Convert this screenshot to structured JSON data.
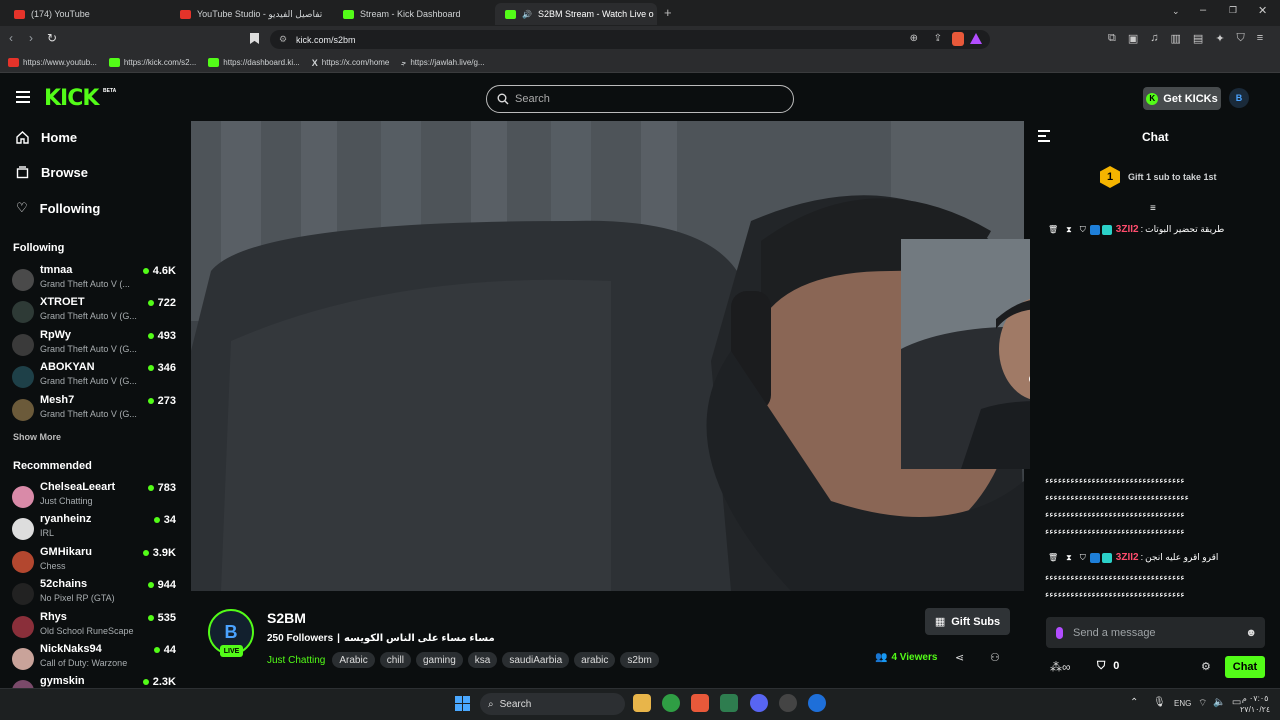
{
  "browser": {
    "tabs": [
      {
        "label": "(174) YouTube"
      },
      {
        "label": "YouTube Studio - تفاصيل الفيديو"
      },
      {
        "label": "Stream - Kick Dashboard"
      },
      {
        "label": "S2BM Stream - Watch Live o"
      }
    ],
    "url": "kick.com/s2bm",
    "bookmarks": [
      {
        "label": "https://www.youtub..."
      },
      {
        "label": "https://kick.com/s2..."
      },
      {
        "label": "https://dashboard.ki..."
      },
      {
        "label": "https://x.com/home"
      },
      {
        "label": "https://jawlah.live/g..."
      }
    ]
  },
  "header": {
    "logo": "KICK",
    "beta": "BETA",
    "search_placeholder": "Search",
    "get_kicks": "Get KICKs",
    "user_initial": "B"
  },
  "sidebar": {
    "nav": [
      {
        "label": "Home",
        "icon": "home-icon"
      },
      {
        "label": "Browse",
        "icon": "browse-icon"
      },
      {
        "label": "Following",
        "icon": "heart-icon"
      }
    ],
    "following_title": "Following",
    "following": [
      {
        "name": "tmnaa",
        "category": "Grand Theft Auto V (...",
        "viewers": "4.6K",
        "color": "#4a4a4a"
      },
      {
        "name": "XTROET",
        "category": "Grand Theft Auto V (G...",
        "viewers": "722",
        "color": "#2e3a36"
      },
      {
        "name": "RpWy",
        "category": "Grand Theft Auto V (G...",
        "viewers": "493",
        "color": "#3a3a3a"
      },
      {
        "name": "ABOKYAN",
        "category": "Grand Theft Auto V (G...",
        "viewers": "346",
        "color": "#1e4048"
      },
      {
        "name": "Mesh7",
        "category": "Grand Theft Auto V (G...",
        "viewers": "273",
        "color": "#6b5a3a"
      }
    ],
    "show_more": "Show More",
    "recommended_title": "Recommended",
    "recommended": [
      {
        "name": "ChelseaLeeart",
        "category": "Just Chatting",
        "viewers": "783",
        "color": "#d98aa8"
      },
      {
        "name": "ryanheinz",
        "category": "IRL",
        "viewers": "34",
        "color": "#dddddd"
      },
      {
        "name": "GMHikaru",
        "category": "Chess",
        "viewers": "3.9K",
        "color": "#b3472f"
      },
      {
        "name": "52chains",
        "category": "No Pixel RP (GTA)",
        "viewers": "944",
        "color": "#222222"
      },
      {
        "name": "Rhys",
        "category": "Old School RuneScape",
        "viewers": "535",
        "color": "#8a2f3a"
      },
      {
        "name": "NickNaks94",
        "category": "Call of Duty: Warzone",
        "viewers": "44",
        "color": "#c9a39a"
      },
      {
        "name": "gymskin",
        "category": "",
        "viewers": "2.3K",
        "color": "#7a4a6a"
      }
    ]
  },
  "stream": {
    "channel": "S2BM",
    "avatar_initial": "B",
    "live": "LIVE",
    "followers": "250 Followers",
    "title": "مساء مساء على الناس الكويسه",
    "category": "Just Chatting",
    "tags": [
      "Arabic",
      "chill",
      "gaming",
      "ksa",
      "saudiAarbia",
      "arabic",
      "s2bm"
    ],
    "viewers": "4 Viewers",
    "gift_subs": "Gift Subs"
  },
  "chat": {
    "title": "Chat",
    "gift_prompt": "Gift 1 sub to take 1st",
    "gift_rank": "1",
    "messages": [
      {
        "user": "3ZII2",
        "text": "طريقة تحضير البوتات"
      },
      {
        "user": "",
        "text": "ءءءءءءءءءءءءءءءءءءءءءءءءءءءءءءءءء"
      },
      {
        "user": "",
        "text": "ءءءءءءءءءءءءءءءءءءءءءءءءءءءءءءءءءء"
      },
      {
        "user": "",
        "text": "ءءءءءءءءءءءءءءءءءءءءءءءءءءءءءءءءء"
      },
      {
        "user": "",
        "text": "ءءءءءءءءءءءءءءءءءءءءءءءءءءءءءءءءء"
      },
      {
        "user": "3ZII2",
        "text": "اقرو اقرو عليه انجن"
      },
      {
        "user": "",
        "text": "ءءءءءءءءءءءءءءءءءءءءءءءءءءءءءءءءء"
      },
      {
        "user": "",
        "text": "ءءءءءءءءءءءءءءءءءءءءءءءءءءءءءءءءء"
      }
    ],
    "input_placeholder": "Send a message",
    "points": "0",
    "send_label": "Chat"
  },
  "taskbar": {
    "search": "Search",
    "lang": "ENG",
    "time": "٠٧:٠٥ م",
    "date": "٢٧/١٠/٢٤"
  },
  "colors": {
    "accent": "#53fc18",
    "bg": "#0b0e0f",
    "username": "#ff4d6d"
  }
}
